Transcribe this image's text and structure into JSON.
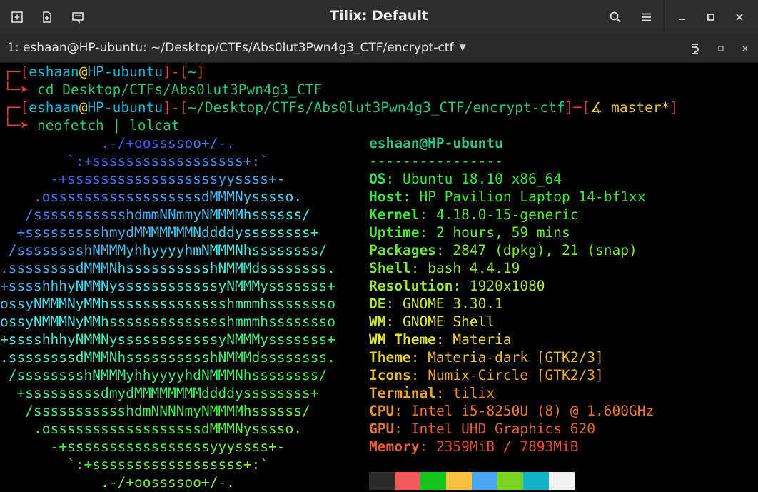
{
  "window": {
    "title": "Tilix: Default"
  },
  "tab": {
    "title": "1: eshaan@HP-ubuntu: ~/Desktop/CTFs/Abs0lut3Pwn4g3_CTF/encrypt-ctf"
  },
  "prompt1": {
    "user": "eshaan",
    "at": "@",
    "host": "HP-ubuntu",
    "dir": "~",
    "cmd": "cd Desktop/CTFs/Abs0lut3Pwn4g3_CTF"
  },
  "prompt2": {
    "user": "eshaan",
    "at": "@",
    "host": "HP-ubuntu",
    "dir": "~/Desktop/CTFs/Abs0lut3Pwn4g3_CTF/encrypt-ctf",
    "branch": "master*",
    "cmd": "neofetch | lolcat"
  },
  "logo": [
    "            .-/+oossssoo+/-.",
    "        `:+ssssssssssssssssss+:`",
    "      -+ssssssssssssssssssyyssss+-",
    "    .ossssssssssssssssssdMMMNysssso.",
    "   /ssssssssssshdmmNNmmyNMMMMhssssss/",
    "  +ssssssssshmydMMMMMMMNddddyssssssss+",
    " /sssssssshNMMMyhhyyyyhmNMMMNhssssssss/",
    ".ssssssssdMMMNhsssssssssshNMMMdssssssss.",
    "+sssshhhyNMMNyssssssssssssyNMMMysssssss+",
    "ossyNMMMNyMMhsssssssssssssshmmmhssssssso",
    "ossyNMMMNyMMhsssssssssssssshmmmhssssssso",
    "+sssshhhyNMMNyssssssssssssyNMMMysssssss+",
    ".ssssssssdMMMNhsssssssssshNMMMdssssssss.",
    " /sssssssshNMMMyhhyyyyhdNMMMNhssssssss/",
    "  +sssssssssdmydMMMMMMMMddddyssssssss+",
    "   /ssssssssssshdmNNNNmyNMMMMhssssss/",
    "    .ossssssssssssssssssdMMMNysssso.",
    "      -+sssssssssssssssssyyyssss+-",
    "        `:+ssssssssssssssssss+:`",
    "            .-/+oossssoo+/-."
  ],
  "info": {
    "userhost": "eshaan@HP-ubuntu",
    "underline": "----------------",
    "rows": [
      {
        "key": "OS",
        "value": "Ubuntu 18.10 x86_64"
      },
      {
        "key": "Host",
        "value": "HP Pavilion Laptop 14-bf1xx"
      },
      {
        "key": "Kernel",
        "value": "4.18.0-15-generic"
      },
      {
        "key": "Uptime",
        "value": "2 hours, 59 mins"
      },
      {
        "key": "Packages",
        "value": "2847 (dpkg), 21 (snap)"
      },
      {
        "key": "Shell",
        "value": "bash 4.4.19"
      },
      {
        "key": "Resolution",
        "value": "1920x1080"
      },
      {
        "key": "DE",
        "value": "GNOME 3.30.1"
      },
      {
        "key": "WM",
        "value": "GNOME Shell"
      },
      {
        "key": "WM Theme",
        "value": "Materia"
      },
      {
        "key": "Theme",
        "value": "Materia-dark [GTK2/3]"
      },
      {
        "key": "Icons",
        "value": "Numix-Circle [GTK2/3]"
      },
      {
        "key": "Terminal",
        "value": "tilix"
      },
      {
        "key": "CPU",
        "value": "Intel i5-8250U (8) @ 1.600GHz"
      },
      {
        "key": "GPU",
        "value": "Intel UHD Graphics 620"
      },
      {
        "key": "Memory",
        "value": "2359MiB / 7893MiB"
      }
    ]
  },
  "palette": [
    "#2b2b2b",
    "#f25a5a",
    "#12c41b",
    "#f7c141",
    "#4aa6f5",
    "#7bd322",
    "#11b3c6",
    "#f2f2f2"
  ],
  "colors": {
    "prompt": "#e0403c",
    "cwd": "#19b5d6",
    "titlebar": "#2d2d2d"
  }
}
